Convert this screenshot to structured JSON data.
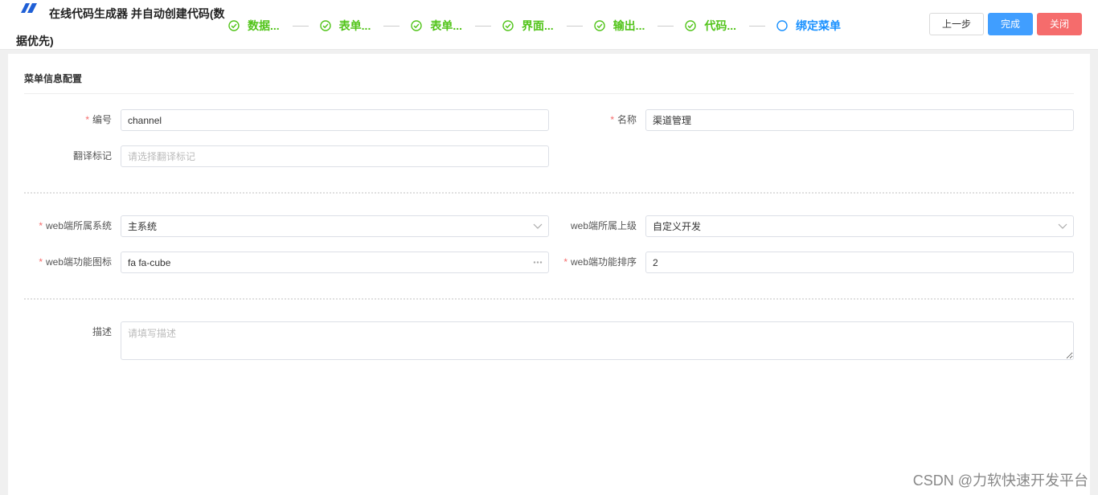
{
  "header": {
    "title": "在线代码生成器 并自动创建代码(数据优先)",
    "steps": [
      {
        "label": "数据...",
        "state": "done"
      },
      {
        "label": "表单...",
        "state": "done"
      },
      {
        "label": "表单...",
        "state": "done"
      },
      {
        "label": "界面...",
        "state": "done"
      },
      {
        "label": "输出...",
        "state": "done"
      },
      {
        "label": "代码...",
        "state": "done"
      },
      {
        "label": "绑定菜单",
        "state": "active"
      }
    ],
    "buttons": {
      "prev": "上一步",
      "done": "完成",
      "close": "关闭"
    }
  },
  "section": {
    "title": "菜单信息配置"
  },
  "form": {
    "code": {
      "label": "编号",
      "value": "channel"
    },
    "name": {
      "label": "名称",
      "value": "渠道管理"
    },
    "translate": {
      "label": "翻译标记",
      "placeholder": "请选择翻译标记"
    },
    "web_system": {
      "label": "web端所属系统",
      "value": "主系统"
    },
    "web_parent": {
      "label": "web端所属上级",
      "value": "自定义开发"
    },
    "web_icon": {
      "label": "web端功能图标",
      "value": "fa fa-cube"
    },
    "web_order": {
      "label": "web端功能排序",
      "value": "2"
    },
    "desc": {
      "label": "描述",
      "placeholder": "请填写描述"
    }
  },
  "watermark": "CSDN @力软快速开发平台",
  "colors": {
    "success": "#52c41a",
    "active": "#1890ff",
    "primary": "#409eff",
    "danger": "#f56c6c"
  }
}
